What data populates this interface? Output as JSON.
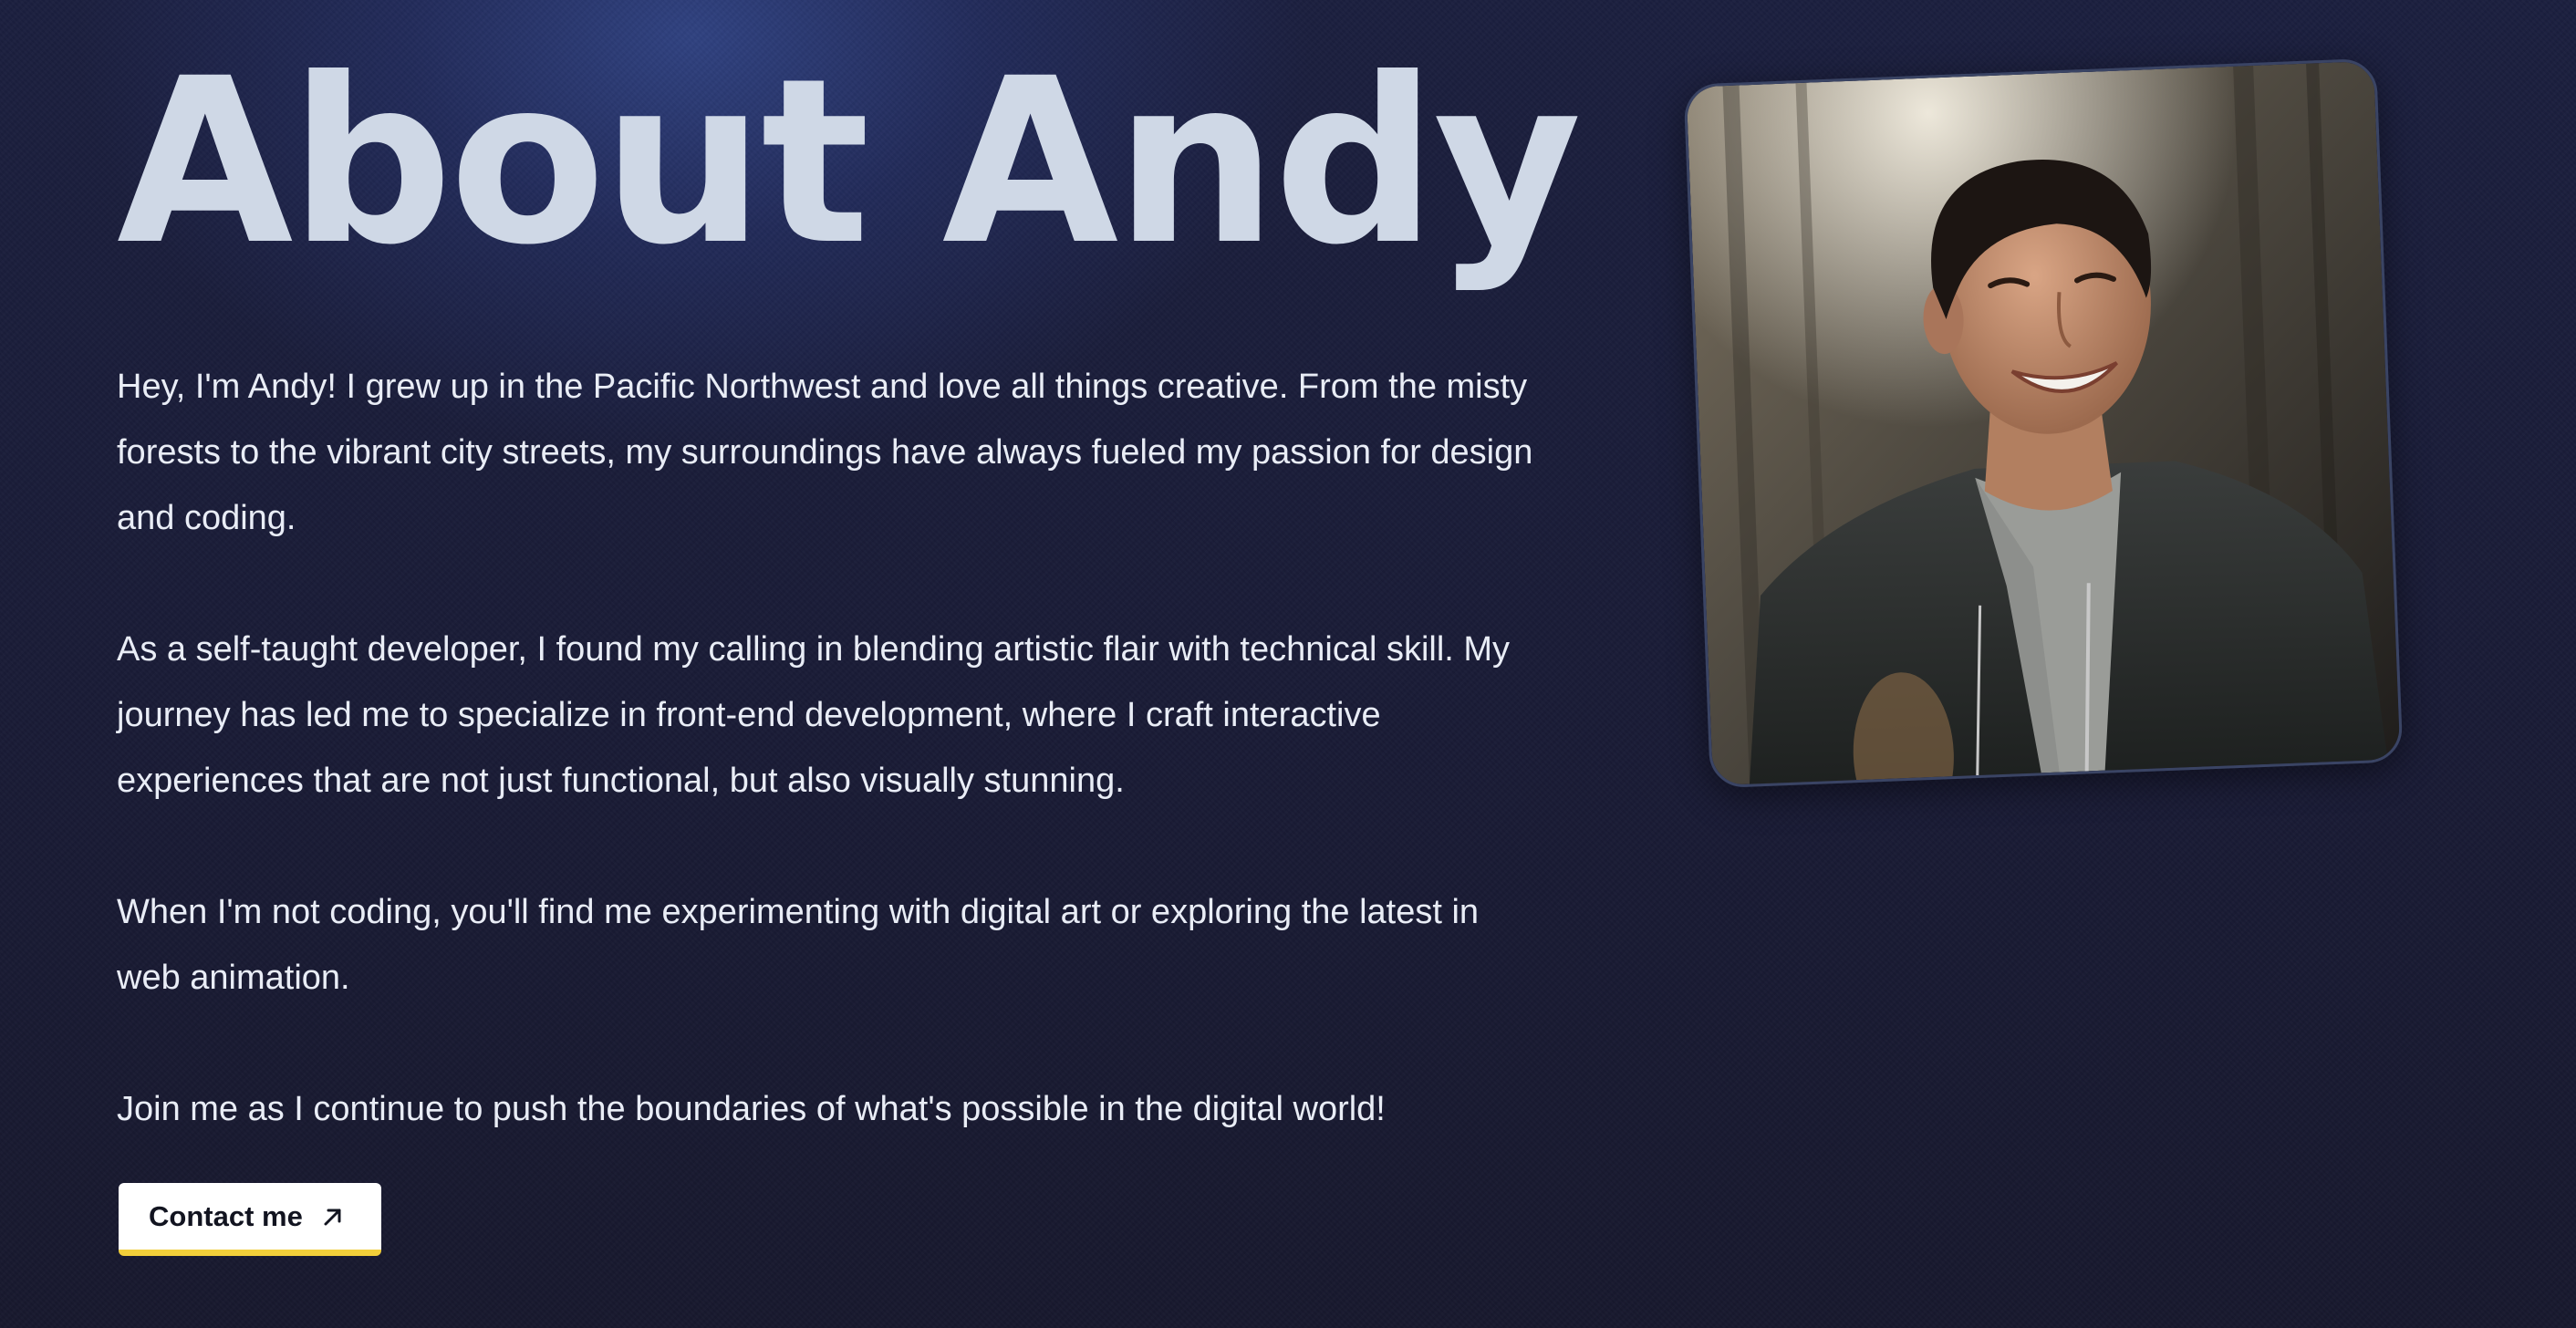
{
  "page": {
    "heading": "About Andy",
    "paragraphs": [
      "Hey, I'm Andy! I grew up in the Pacific Northwest and love all things creative. From the misty forests to the vibrant city streets, my surroundings have always fueled my passion for design and coding.",
      "As a self-taught developer, I found my calling in blending artistic flair with technical skill. My journey has led me to specialize in front-end development, where I craft interactive experiences that are not just functional, but also visually stunning.",
      "When I'm not coding, you'll find me experimenting with digital art or exploring the latest in web animation.",
      "Join me as I continue to push the boundaries of what's possible in the digital world!"
    ],
    "cta": {
      "label": "Contact me",
      "icon": "arrow-up-right-icon"
    },
    "photo": {
      "subject": "portrait"
    }
  },
  "colors": {
    "background": "#1b1f3f",
    "heading": "#cfd8e6",
    "body_text": "#e9edf6",
    "button_bg": "#ffffff",
    "button_accent": "#f2cf3a"
  }
}
